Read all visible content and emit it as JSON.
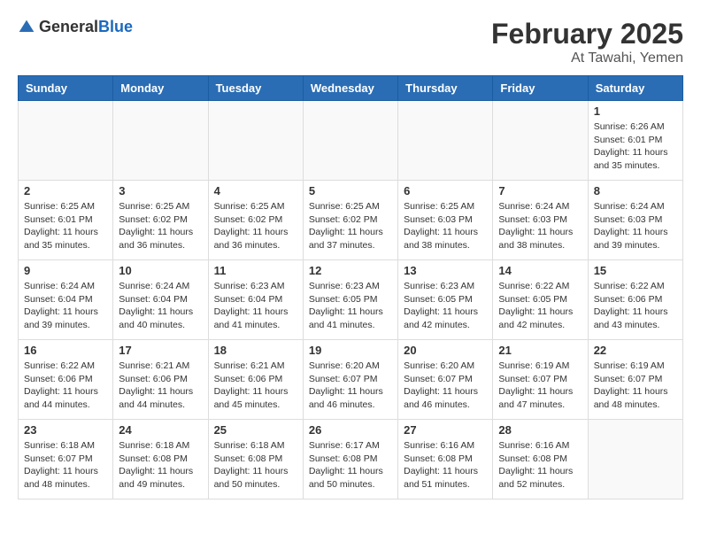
{
  "header": {
    "logo_general": "General",
    "logo_blue": "Blue",
    "month_title": "February 2025",
    "location": "At Tawahi, Yemen"
  },
  "weekdays": [
    "Sunday",
    "Monday",
    "Tuesday",
    "Wednesday",
    "Thursday",
    "Friday",
    "Saturday"
  ],
  "weeks": [
    [
      {
        "day": "",
        "info": ""
      },
      {
        "day": "",
        "info": ""
      },
      {
        "day": "",
        "info": ""
      },
      {
        "day": "",
        "info": ""
      },
      {
        "day": "",
        "info": ""
      },
      {
        "day": "",
        "info": ""
      },
      {
        "day": "1",
        "info": "Sunrise: 6:26 AM\nSunset: 6:01 PM\nDaylight: 11 hours and 35 minutes."
      }
    ],
    [
      {
        "day": "2",
        "info": "Sunrise: 6:25 AM\nSunset: 6:01 PM\nDaylight: 11 hours and 35 minutes."
      },
      {
        "day": "3",
        "info": "Sunrise: 6:25 AM\nSunset: 6:02 PM\nDaylight: 11 hours and 36 minutes."
      },
      {
        "day": "4",
        "info": "Sunrise: 6:25 AM\nSunset: 6:02 PM\nDaylight: 11 hours and 36 minutes."
      },
      {
        "day": "5",
        "info": "Sunrise: 6:25 AM\nSunset: 6:02 PM\nDaylight: 11 hours and 37 minutes."
      },
      {
        "day": "6",
        "info": "Sunrise: 6:25 AM\nSunset: 6:03 PM\nDaylight: 11 hours and 38 minutes."
      },
      {
        "day": "7",
        "info": "Sunrise: 6:24 AM\nSunset: 6:03 PM\nDaylight: 11 hours and 38 minutes."
      },
      {
        "day": "8",
        "info": "Sunrise: 6:24 AM\nSunset: 6:03 PM\nDaylight: 11 hours and 39 minutes."
      }
    ],
    [
      {
        "day": "9",
        "info": "Sunrise: 6:24 AM\nSunset: 6:04 PM\nDaylight: 11 hours and 39 minutes."
      },
      {
        "day": "10",
        "info": "Sunrise: 6:24 AM\nSunset: 6:04 PM\nDaylight: 11 hours and 40 minutes."
      },
      {
        "day": "11",
        "info": "Sunrise: 6:23 AM\nSunset: 6:04 PM\nDaylight: 11 hours and 41 minutes."
      },
      {
        "day": "12",
        "info": "Sunrise: 6:23 AM\nSunset: 6:05 PM\nDaylight: 11 hours and 41 minutes."
      },
      {
        "day": "13",
        "info": "Sunrise: 6:23 AM\nSunset: 6:05 PM\nDaylight: 11 hours and 42 minutes."
      },
      {
        "day": "14",
        "info": "Sunrise: 6:22 AM\nSunset: 6:05 PM\nDaylight: 11 hours and 42 minutes."
      },
      {
        "day": "15",
        "info": "Sunrise: 6:22 AM\nSunset: 6:06 PM\nDaylight: 11 hours and 43 minutes."
      }
    ],
    [
      {
        "day": "16",
        "info": "Sunrise: 6:22 AM\nSunset: 6:06 PM\nDaylight: 11 hours and 44 minutes."
      },
      {
        "day": "17",
        "info": "Sunrise: 6:21 AM\nSunset: 6:06 PM\nDaylight: 11 hours and 44 minutes."
      },
      {
        "day": "18",
        "info": "Sunrise: 6:21 AM\nSunset: 6:06 PM\nDaylight: 11 hours and 45 minutes."
      },
      {
        "day": "19",
        "info": "Sunrise: 6:20 AM\nSunset: 6:07 PM\nDaylight: 11 hours and 46 minutes."
      },
      {
        "day": "20",
        "info": "Sunrise: 6:20 AM\nSunset: 6:07 PM\nDaylight: 11 hours and 46 minutes."
      },
      {
        "day": "21",
        "info": "Sunrise: 6:19 AM\nSunset: 6:07 PM\nDaylight: 11 hours and 47 minutes."
      },
      {
        "day": "22",
        "info": "Sunrise: 6:19 AM\nSunset: 6:07 PM\nDaylight: 11 hours and 48 minutes."
      }
    ],
    [
      {
        "day": "23",
        "info": "Sunrise: 6:18 AM\nSunset: 6:07 PM\nDaylight: 11 hours and 48 minutes."
      },
      {
        "day": "24",
        "info": "Sunrise: 6:18 AM\nSunset: 6:08 PM\nDaylight: 11 hours and 49 minutes."
      },
      {
        "day": "25",
        "info": "Sunrise: 6:18 AM\nSunset: 6:08 PM\nDaylight: 11 hours and 50 minutes."
      },
      {
        "day": "26",
        "info": "Sunrise: 6:17 AM\nSunset: 6:08 PM\nDaylight: 11 hours and 50 minutes."
      },
      {
        "day": "27",
        "info": "Sunrise: 6:16 AM\nSunset: 6:08 PM\nDaylight: 11 hours and 51 minutes."
      },
      {
        "day": "28",
        "info": "Sunrise: 6:16 AM\nSunset: 6:08 PM\nDaylight: 11 hours and 52 minutes."
      },
      {
        "day": "",
        "info": ""
      }
    ]
  ]
}
